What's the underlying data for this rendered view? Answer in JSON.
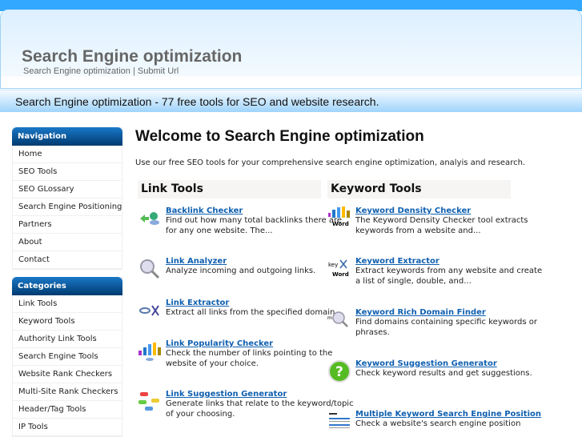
{
  "header": {
    "title": "Search Engine optimization",
    "subnav": [
      "Search Engine optimization",
      "Submit Url"
    ],
    "separator": "|"
  },
  "banner": "Search Engine optimization - 77 free tools for SEO and website research.",
  "navigation": {
    "title": "Navigation",
    "items": [
      "Home",
      "SEO Tools",
      "SEO GLossary",
      "Search Engine Positioning",
      "Partners",
      "About",
      "Contact"
    ]
  },
  "categories": {
    "title": "Categories",
    "items": [
      "Link Tools",
      "Keyword Tools",
      "Authority Link Tools",
      "Search Engine Tools",
      "Website Rank Checkers",
      "Multi-Site Rank Checkers",
      "Header/Tag Tools",
      "IP Tools"
    ]
  },
  "main": {
    "title": "Welcome to Search Engine optimization",
    "intro": "Use our free SEO tools for your comprehensive search engine optimization, analyis and research.",
    "link_tools": {
      "title": "Link Tools",
      "items": [
        {
          "name": "Backlink Checker",
          "desc": "Find out how many total backlinks there are for any one website. The...",
          "icon": "backlink-icon"
        },
        {
          "name": "Link Analyzer",
          "desc": "Analyze incoming and outgoing links.",
          "icon": "magnifier-link-icon"
        },
        {
          "name": "Link Extractor",
          "desc": "Extract all links from the specified domain.",
          "icon": "scissors-link-icon"
        },
        {
          "name": "Link Popularity Checker",
          "desc": "Check the number of links pointing to the website of your choice.",
          "icon": "bar-chart-icon"
        },
        {
          "name": "Link Suggestion Generator",
          "desc": "Generate links that relate to the keyword/topic of your choosing.",
          "icon": "links-icon"
        }
      ]
    },
    "keyword_tools": {
      "title": "Keyword Tools",
      "items": [
        {
          "name": "Keyword Density Checker",
          "desc": "The Keyword Density Checker tool extracts keywords from a website and...",
          "icon": "keyword-chart-icon"
        },
        {
          "name": "Keyword Extractor",
          "desc": "Extract keywords from any website and create a list of single, double, and...",
          "icon": "keyword-scissors-icon"
        },
        {
          "name": "Keyword Rich Domain Finder",
          "desc": "Find domains containing specific keywords or phrases.",
          "icon": "domain-magnifier-icon"
        },
        {
          "name": "Keyword Suggestion Generator",
          "desc": "Check keyword results and get suggestions.",
          "icon": "question-icon"
        },
        {
          "name": "Multiple Keyword Search Engine Position",
          "desc": "Check a website's search engine position",
          "icon": "serp-icon"
        }
      ]
    }
  }
}
